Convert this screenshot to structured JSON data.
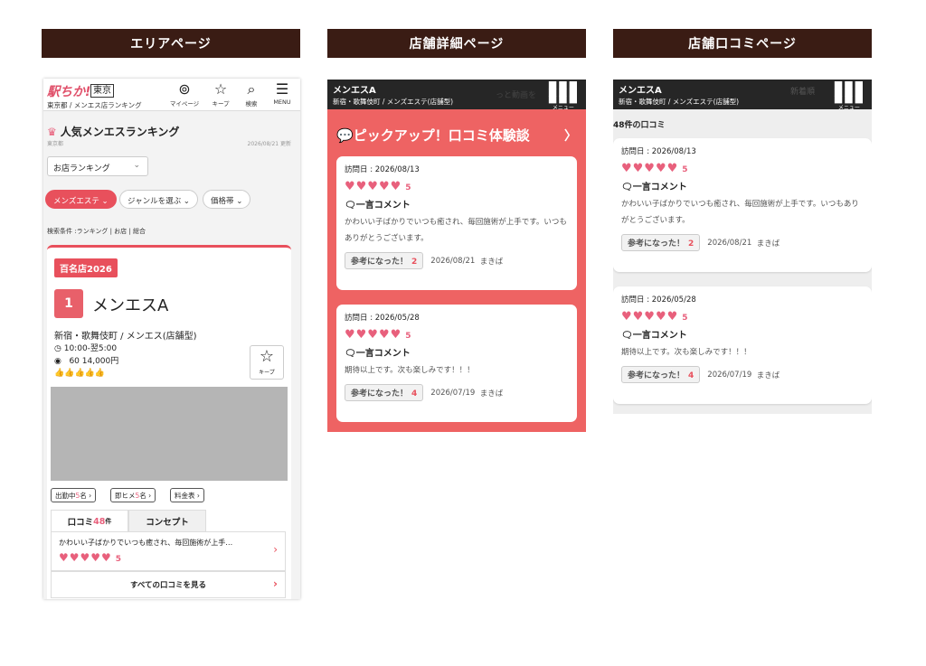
{
  "columns": {
    "area": "エリアページ",
    "detail": "店舗詳細ページ",
    "reviews": "店舗口コミページ"
  },
  "area_page": {
    "logo": "駅ちか!",
    "prefecture": "東京",
    "breadcrumb": "東京都 / メンエス店ランキング",
    "nav": [
      {
        "icon": "user-icon",
        "glyph": "⊚",
        "label": "マイページ"
      },
      {
        "icon": "star-icon",
        "glyph": "☆",
        "label": "キープ"
      },
      {
        "icon": "search-icon",
        "glyph": "⌕",
        "label": "検索"
      },
      {
        "icon": "menu-icon",
        "glyph": "☰",
        "label": "MENU"
      }
    ],
    "ranking_title": "人気メンエスランキング",
    "ranking_sub": "東京都",
    "update_date": "2026/08/21 更新",
    "sort_select": "お店ランキング",
    "chips": {
      "genre_active": "メンズエステ",
      "genre": "ジャンルを選ぶ",
      "price": "価格帯"
    },
    "search_condition": "検索条件 :ランキング | お店 | 総合",
    "shop": {
      "badge": "百名店2026",
      "rank": "1",
      "name": "メンエスA",
      "area": "新宿・歌舞伎町 / メンエス(店舗型)",
      "hours": "10:00-翌5:00",
      "price": "60 14,000円",
      "keep_label": "キープ",
      "pill_working_pre": "出勤中",
      "pill_working_num": "5",
      "pill_working_post": "名",
      "pill_now_pre": "即ヒメ",
      "pill_now_num": "5",
      "pill_now_post": "名",
      "pill_fee": "料金表",
      "tab_reviews_pre": "口コミ",
      "tab_reviews_num": "48",
      "tab_reviews_post": "件",
      "tab_concept": "コンセプト",
      "review_excerpt": "かわいい子ばかりでいつも癒され、毎回施術が上手…",
      "review_score": "5",
      "all_reviews": "すべての口コミを見る"
    }
  },
  "detail_page": {
    "shop_name": "メンエスA",
    "shop_category": "新宿・歌舞伎町 / メンズエステ(店舗型)",
    "overlay_text": "っと動画を",
    "menu_label": "メニュー",
    "pickup_title": "ピックアップ！口コミ体験談",
    "reviews": [
      {
        "visit_date": "訪問日 : 2026/08/13",
        "score": "5",
        "comment_title": "一言コメント",
        "text": "かわいい子ばかりでいつも癒され、毎回施術が上手です。いつもありがとうございます。",
        "helpful_label": "参考になった！",
        "helpful_count": "2",
        "post_date": "2026/08/21",
        "author": "まきば"
      },
      {
        "visit_date": "訪問日 : 2026/05/28",
        "score": "5",
        "comment_title": "一言コメント",
        "text": "期待以上です。次も楽しみです！！！",
        "helpful_label": "参考になった！",
        "helpful_count": "4",
        "post_date": "2026/07/19",
        "author": "まきば"
      }
    ]
  },
  "reviews_page": {
    "shop_name": "メンエスA",
    "shop_category": "新宿・歌舞伎町 / メンズエステ(店舗型)",
    "overlay_text": "新着順",
    "menu_label": "メニュー",
    "count_title": "48件の口コミ",
    "reviews": [
      {
        "visit_date": "訪問日 : 2026/08/13",
        "score": "5",
        "comment_title": "一言コメント",
        "text": "かわいい子ばかりでいつも癒され、毎回施術が上手です。いつもありがとうございます。",
        "helpful_label": "参考になった！",
        "helpful_count": "2",
        "post_date": "2026/08/21",
        "author": "まきば"
      },
      {
        "visit_date": "訪問日 : 2026/05/28",
        "score": "5",
        "comment_title": "一言コメント",
        "text": "期待以上です。次も楽しみです！！！",
        "helpful_label": "参考になった！",
        "helpful_count": "4",
        "post_date": "2026/07/19",
        "author": "まきば"
      }
    ]
  },
  "colors": {
    "header_bg": "#3a1c14",
    "accent": "#e8505c",
    "detail_bg": "#ee6363",
    "heart": "#e8607c"
  }
}
